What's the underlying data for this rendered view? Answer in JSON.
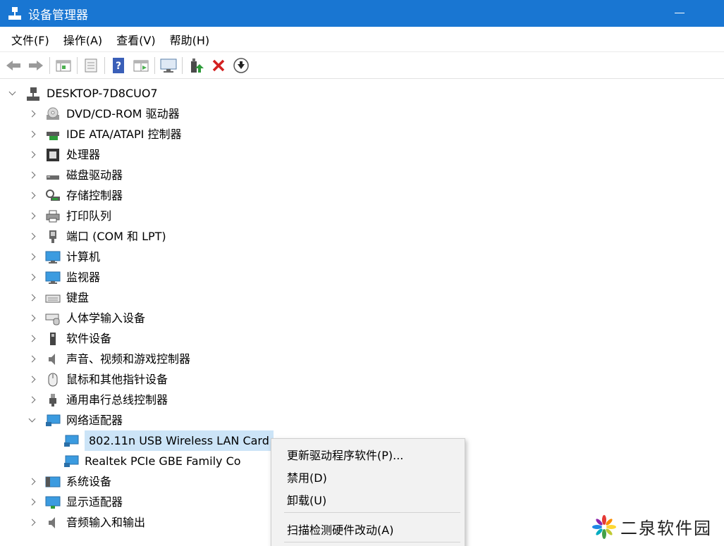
{
  "window": {
    "title": "设备管理器"
  },
  "menu": [
    "文件(F)",
    "操作(A)",
    "查看(V)",
    "帮助(H)"
  ],
  "toolbar": [
    "back-arrow-icon",
    "forward-arrow-icon",
    "properties-grid-icon",
    "page-icon",
    "help-icon",
    "panel-icon",
    "monitor-scan-icon",
    "update-driver-icon",
    "uninstall-x-icon",
    "download-circle-icon"
  ],
  "tree": {
    "root": "DESKTOP-7D8CUO7",
    "categories": [
      {
        "label": "DVD/CD-ROM 驱动器",
        "icon": "dvd-drive-icon"
      },
      {
        "label": "IDE ATA/ATAPI 控制器",
        "icon": "ide-controller-icon"
      },
      {
        "label": "处理器",
        "icon": "processor-icon"
      },
      {
        "label": "磁盘驱动器",
        "icon": "disk-drive-icon"
      },
      {
        "label": "存储控制器",
        "icon": "storage-controller-icon"
      },
      {
        "label": "打印队列",
        "icon": "printer-icon"
      },
      {
        "label": "端口 (COM 和 LPT)",
        "icon": "port-icon"
      },
      {
        "label": "计算机",
        "icon": "computer-icon"
      },
      {
        "label": "监视器",
        "icon": "monitor-icon"
      },
      {
        "label": "键盘",
        "icon": "keyboard-icon"
      },
      {
        "label": "人体学输入设备",
        "icon": "hid-icon"
      },
      {
        "label": "软件设备",
        "icon": "software-device-icon"
      },
      {
        "label": "声音、视频和游戏控制器",
        "icon": "speaker-icon"
      },
      {
        "label": "鼠标和其他指针设备",
        "icon": "mouse-icon"
      },
      {
        "label": "通用串行总线控制器",
        "icon": "usb-icon"
      },
      {
        "label": "网络适配器",
        "icon": "network-adapter-icon"
      }
    ],
    "network_children": [
      {
        "label": "802.11n USB Wireless LAN Card"
      },
      {
        "label": "Realtek PCIe GBE Family Co"
      }
    ],
    "after": [
      {
        "label": "系统设备",
        "icon": "system-device-icon"
      },
      {
        "label": "显示适配器",
        "icon": "display-adapter-icon"
      },
      {
        "label": "音频输入和输出",
        "icon": "audio-io-icon"
      }
    ]
  },
  "context_menu": [
    "更新驱动程序软件(P)...",
    "禁用(D)",
    "卸载(U)",
    "扫描检测硬件改动(A)"
  ],
  "watermark": "二泉软件园",
  "colors": {
    "titlebar": "#1976d2",
    "selection": "#cce4f7"
  }
}
